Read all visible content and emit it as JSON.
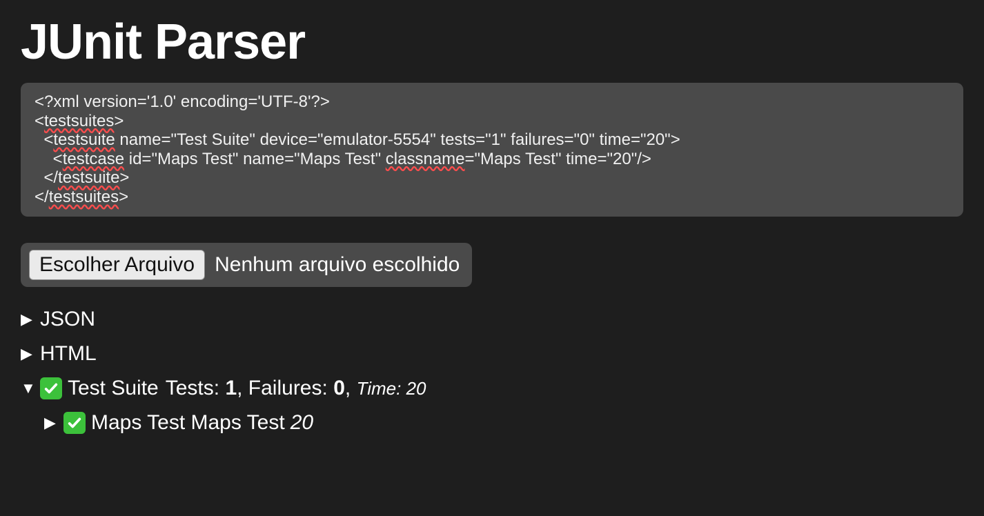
{
  "title": "JUnit Parser",
  "xml": {
    "line1": "<?xml version='1.0' encoding='UTF-8'?>",
    "line2_open": "<",
    "line2_tag": "testsuites",
    "line2_close": ">",
    "line3_prefix": "  <",
    "line3_tag": "testsuite",
    "line3_rest": " name=\"Test Suite\" device=\"emulator-5554\" tests=\"1\" failures=\"0\" time=\"20\">",
    "line4_prefix": "    <",
    "line4_tag": "testcase",
    "line4_mid1": " id=\"Maps Test\" name=\"Maps Test\" ",
    "line4_classname": "classname",
    "line4_rest": "=\"Maps Test\" time=\"20\"/>",
    "line5_prefix": "  </",
    "line5_tag": "testsuite",
    "line5_close": ">",
    "line6_prefix": "</",
    "line6_tag": "testsuites",
    "line6_close": ">"
  },
  "filePicker": {
    "buttonLabel": "Escolher Arquivo",
    "statusText": "Nenhum arquivo escolhido"
  },
  "tree": {
    "jsonLabel": "JSON",
    "htmlLabel": "HTML",
    "suite": {
      "name": "Test Suite",
      "testsLabel": "Tests:",
      "testsValue": "1",
      "failuresLabel": ", Failures:",
      "failuresValue": "0",
      "sep": ",",
      "timeLabel": " Time: ",
      "timeValue": "20",
      "case": {
        "name": "Maps Test Maps Test",
        "time": "20"
      }
    }
  },
  "arrows": {
    "right": "▶",
    "down": "▼"
  }
}
